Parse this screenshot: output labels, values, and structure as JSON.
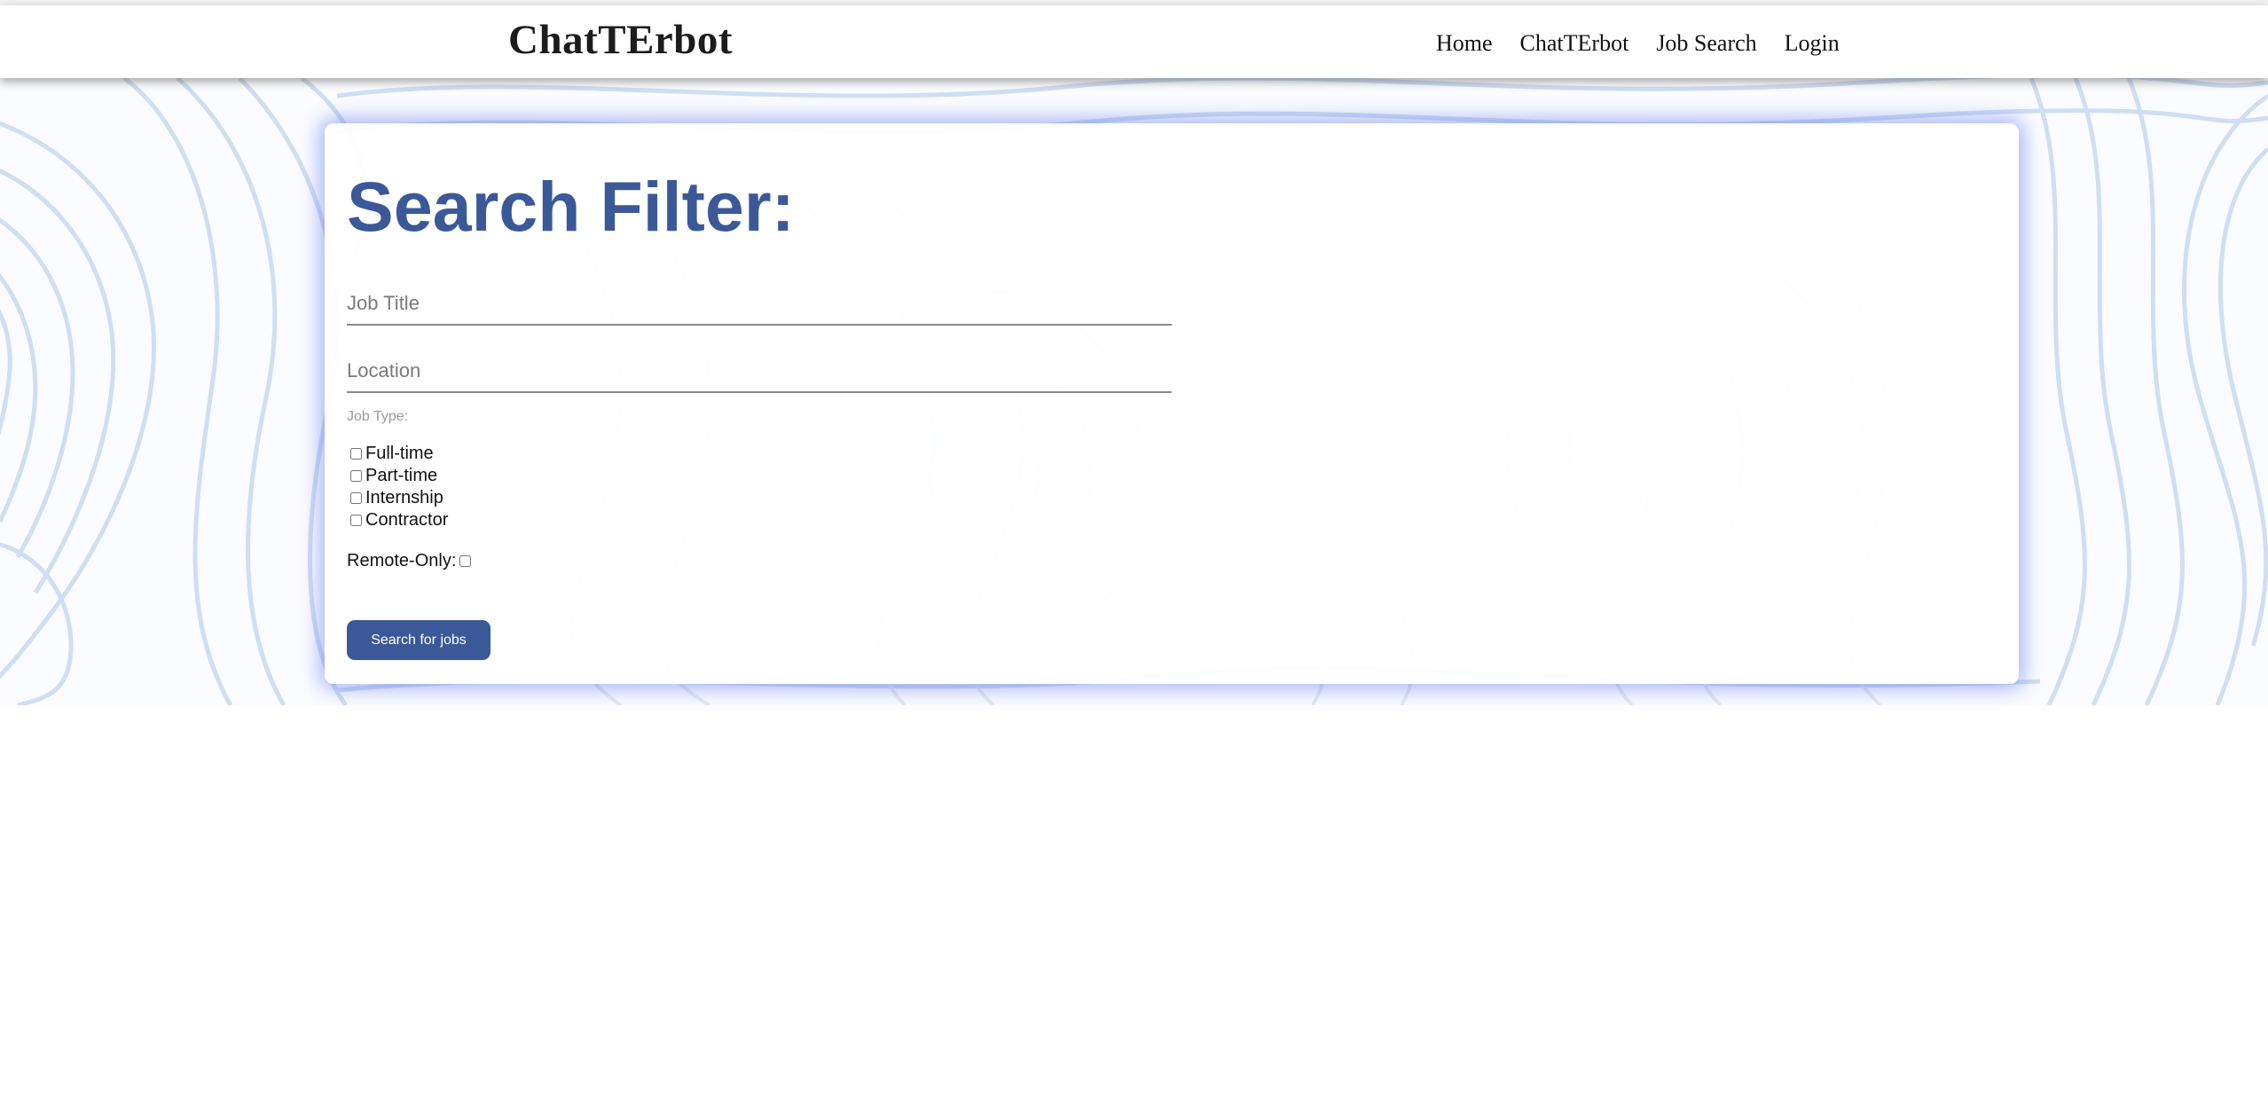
{
  "navbar": {
    "brand": "ChatTErbot",
    "links": [
      {
        "label": "Home"
      },
      {
        "label": "ChatTErbot"
      },
      {
        "label": "Job Search"
      },
      {
        "label": "Login"
      }
    ]
  },
  "search_filter": {
    "title": "Search Filter:",
    "job_title_placeholder": "Job Title",
    "job_title_value": "",
    "location_placeholder": "Location",
    "location_value": "",
    "job_type_label": "Job Type:",
    "job_types": [
      {
        "label": "Full-time",
        "checked": false
      },
      {
        "label": "Part-time",
        "checked": false
      },
      {
        "label": "Internship",
        "checked": false
      },
      {
        "label": "Contractor",
        "checked": false
      }
    ],
    "remote_only_label": "Remote-Only:",
    "remote_only_checked": false,
    "submit_label": "Search for jobs"
  },
  "colors": {
    "accent": "#3b5998",
    "pattern": "#c9d9f2",
    "card_glow": "#4664e6"
  },
  "icons": {
    "background_pattern": "topographic-lines-pattern"
  }
}
